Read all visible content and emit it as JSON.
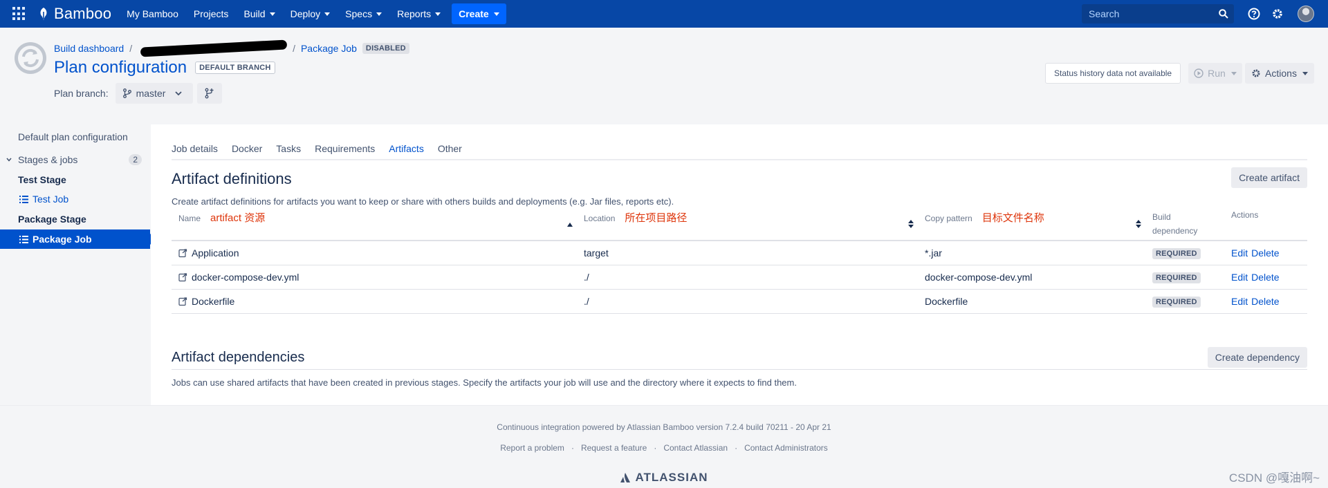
{
  "topnav": {
    "brand": "Bamboo",
    "items": [
      "My Bamboo",
      "Projects",
      "Build",
      "Deploy",
      "Specs",
      "Reports"
    ],
    "create_label": "Create",
    "search_placeholder": "Search",
    "colors": {
      "bar": "#0747a6",
      "create": "#0065ff"
    }
  },
  "header": {
    "breadcrumb": {
      "dashboard": "Build dashboard",
      "job": "Package Job",
      "job_status": "DISABLED"
    },
    "title": "Plan configuration",
    "title_badge": "DEFAULT BRANCH",
    "branch_label": "Plan branch:",
    "branch_value": "master",
    "status_text": "Status history data not available",
    "run_label": "Run",
    "actions_label": "Actions"
  },
  "sidebar": {
    "default_config": "Default plan configuration",
    "stages_label": "Stages & jobs",
    "stages_count": "2",
    "stage1": "Test Stage",
    "job1": "Test Job",
    "stage2": "Package Stage",
    "job2": "Package Job"
  },
  "tabs": [
    "Job details",
    "Docker",
    "Tasks",
    "Requirements",
    "Artifacts",
    "Other"
  ],
  "active_tab": "Artifacts",
  "artifact_definitions": {
    "title": "Artifact definitions",
    "description": "Create artifact definitions for artifacts you want to keep or share with others builds and deployments (e.g. Jar files, reports etc).",
    "create_button": "Create artifact",
    "columns": {
      "name": "Name",
      "name_note": "artifact 资源",
      "location": "Location",
      "location_note": "所在项目路径",
      "copy_pattern": "Copy pattern",
      "copy_note": "目标文件名称",
      "build_dependency_1": "Build",
      "build_dependency_2": "dependency",
      "actions": "Actions"
    },
    "rows": [
      {
        "name": "Application",
        "location": "target",
        "pattern": "*.jar",
        "dependency": "REQUIRED",
        "edit": "Edit",
        "delete": "Delete"
      },
      {
        "name": "docker-compose-dev.yml",
        "location": "./",
        "pattern": "docker-compose-dev.yml",
        "dependency": "REQUIRED",
        "edit": "Edit",
        "delete": "Delete"
      },
      {
        "name": "Dockerfile",
        "location": "./",
        "pattern": "Dockerfile",
        "dependency": "REQUIRED",
        "edit": "Edit",
        "delete": "Delete"
      }
    ]
  },
  "artifact_dependencies": {
    "title": "Artifact dependencies",
    "description": "Jobs can use shared artifacts that have been created in previous stages. Specify the artifacts your job will use and the directory where it expects to find them.",
    "create_button": "Create dependency"
  },
  "footer": {
    "powered_by": "Continuous integration powered by Atlassian Bamboo version 7.2.4 build 70211 - 20 Apr 21",
    "links": [
      "Report a problem",
      "Request a feature",
      "Contact Atlassian",
      "Contact Administrators"
    ],
    "logo": "ATLASSIAN",
    "watermark": "CSDN @嘎油啊~"
  }
}
